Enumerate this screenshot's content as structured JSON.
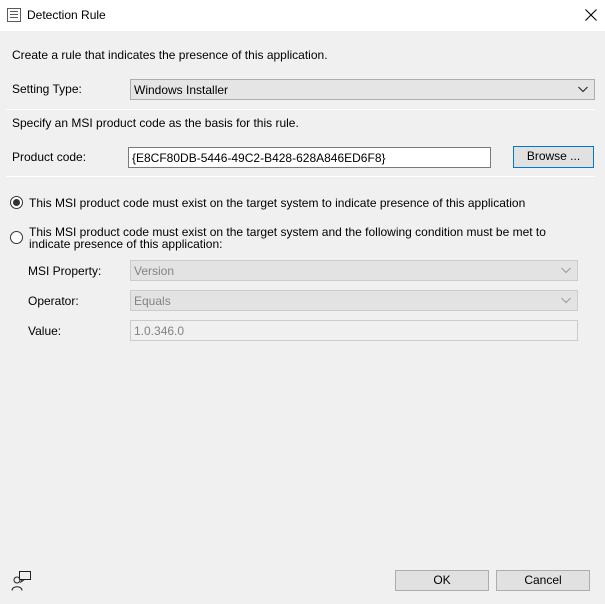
{
  "window": {
    "title": "Detection Rule",
    "icon": "dialog-icon",
    "close_icon": "close-icon"
  },
  "intro": "Create a rule that indicates the presence of this application.",
  "setting_type": {
    "label": "Setting Type:",
    "value": "Windows Installer"
  },
  "specify_text": "Specify an MSI product code as the basis for this rule.",
  "product_code": {
    "label": "Product code:",
    "value": "{E8CF80DB-5446-49C2-B428-628A846ED6F8}",
    "browse_label": "Browse ..."
  },
  "options": [
    {
      "label": "This MSI product code must exist on the target system to indicate presence of this application",
      "selected": true
    },
    {
      "label": "This MSI product code must exist on the target system and the following condition must be met to indicate presence of this application:",
      "selected": false
    }
  ],
  "condition": {
    "msi_property": {
      "label": "MSI Property:",
      "value": "Version"
    },
    "operator": {
      "label": "Operator:",
      "value": "Equals"
    },
    "value": {
      "label": "Value:",
      "value": "1.0.346.0"
    }
  },
  "footer": {
    "ok_label": "OK",
    "cancel_label": "Cancel",
    "feedback_icon": "feedback-icon"
  }
}
